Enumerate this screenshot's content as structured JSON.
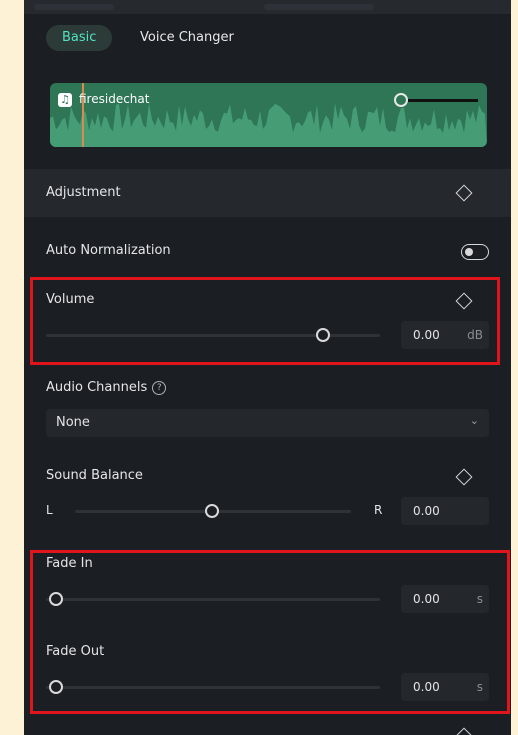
{
  "tabs": [
    {
      "label": "Basic"
    },
    {
      "label": "Voice Changer"
    }
  ],
  "clip": {
    "name": "firesidechat",
    "volume_line_level": 0.0
  },
  "adjustment": {
    "title": "Adjustment"
  },
  "auto_normalization": {
    "label": "Auto Normalization",
    "enabled": false
  },
  "volume": {
    "label": "Volume",
    "value": "0.00",
    "unit": "dB",
    "slider_position": 0.83
  },
  "audio_channels": {
    "label": "Audio Channels",
    "help_icon": "?",
    "selected": "None",
    "chevron": "⌄"
  },
  "sound_balance": {
    "label": "Sound Balance",
    "left": "L",
    "right": "R",
    "value": "0.00",
    "slider_position": 0.5
  },
  "fade_in": {
    "label": "Fade In",
    "value": "0.00",
    "unit": "s",
    "slider_position": 0.0
  },
  "fade_out": {
    "label": "Fade Out",
    "value": "0.00",
    "unit": "s",
    "slider_position": 0.0
  },
  "colors": {
    "accent": "#50e3c2",
    "waveform": "#2e7656",
    "highlight": "#e0141b",
    "panel": "#1b1e22"
  }
}
